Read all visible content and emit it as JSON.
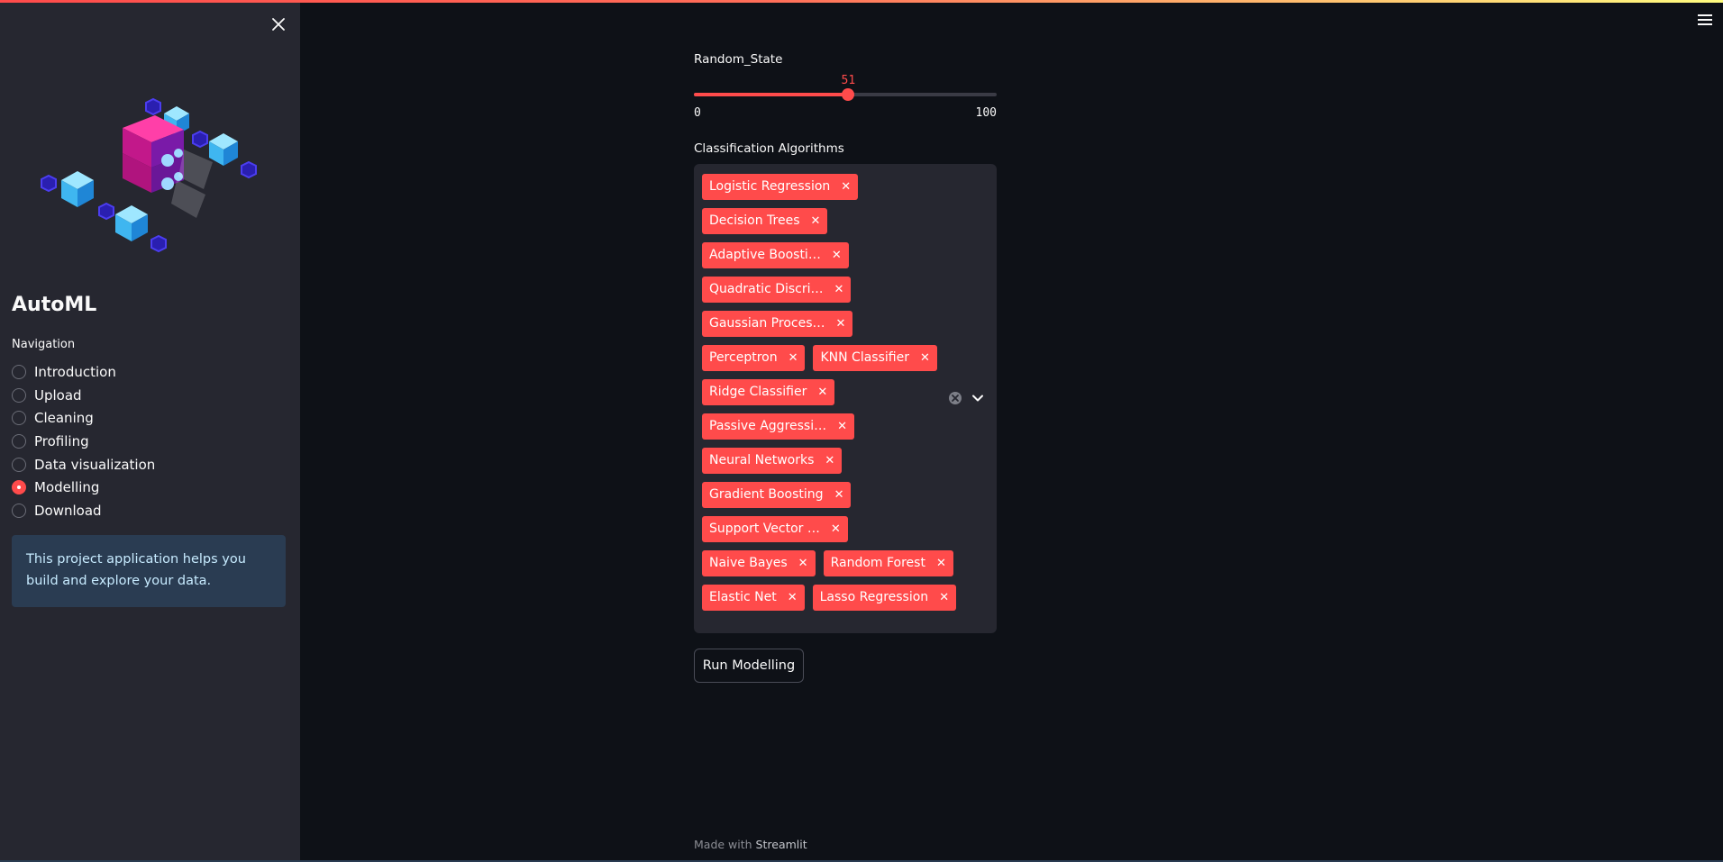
{
  "sidebar": {
    "app_title": "AutoML",
    "nav_label": "Navigation",
    "nav_items": [
      {
        "label": "Introduction",
        "selected": false
      },
      {
        "label": "Upload",
        "selected": false
      },
      {
        "label": "Cleaning",
        "selected": false
      },
      {
        "label": "Profiling",
        "selected": false
      },
      {
        "label": "Data visualization",
        "selected": false
      },
      {
        "label": "Modelling",
        "selected": true
      },
      {
        "label": "Download",
        "selected": false
      }
    ],
    "info_text": "This project application helps you build and explore your data."
  },
  "slider": {
    "label": "Random_State",
    "value": "51",
    "min": "0",
    "max": "100"
  },
  "multiselect": {
    "label": "Classification Algorithms",
    "chips": [
      "Logistic Regression",
      "Decision Trees",
      "Adaptive Boosti…",
      "Quadratic Discri…",
      "Gaussian Proces…",
      "Perceptron",
      "KNN Classifier",
      "Ridge Classifier",
      "Passive Aggressi…",
      "Neural Networks",
      "Gradient Boosting",
      "Support Vector …",
      "Naive Bayes",
      "Random Forest",
      "Elastic Net",
      "Lasso Regression"
    ]
  },
  "run_button_label": "Run Modelling",
  "footer": {
    "prefix": "Made with ",
    "brand": "Streamlit"
  },
  "colors": {
    "accent": "#ff4b4b",
    "sidebar_bg": "#262730",
    "main_bg": "#0e1117",
    "info_bg": "#2a3c52"
  }
}
